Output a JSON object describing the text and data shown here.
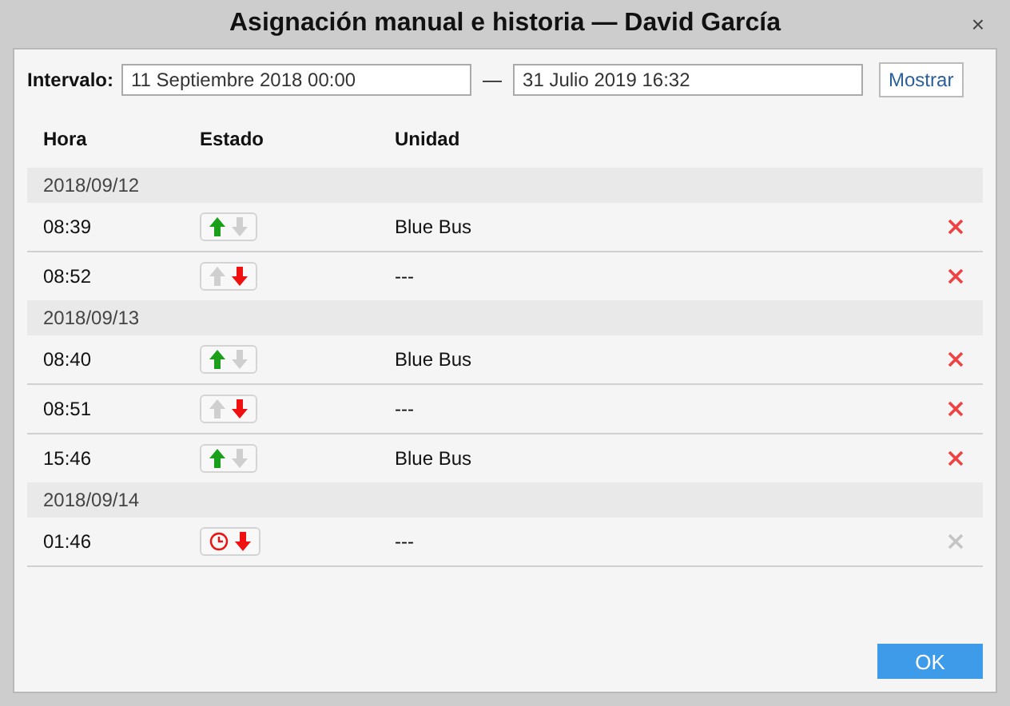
{
  "window": {
    "title": "Asignación manual e historia — David García",
    "close": "×"
  },
  "interval": {
    "label": "Intervalo:",
    "from": "11 Septiembre 2018 00:00",
    "separator": "—",
    "to": "31 Julio 2019 16:32",
    "button": "Mostrar"
  },
  "table": {
    "columns": [
      "Hora",
      "Estado",
      "Unidad"
    ],
    "groups": [
      {
        "date": "2018/09/12",
        "rows": [
          {
            "time": "08:39",
            "entered": true,
            "kind": "arrow",
            "unit": "Blue Bus",
            "delete_disabled": false
          },
          {
            "time": "08:52",
            "entered": false,
            "kind": "arrow",
            "unit": "---",
            "delete_disabled": false
          }
        ]
      },
      {
        "date": "2018/09/13",
        "rows": [
          {
            "time": "08:40",
            "entered": true,
            "kind": "arrow",
            "unit": "Blue Bus",
            "delete_disabled": false
          },
          {
            "time": "08:51",
            "entered": false,
            "kind": "arrow",
            "unit": "---",
            "delete_disabled": false
          },
          {
            "time": "15:46",
            "entered": true,
            "kind": "arrow",
            "unit": "Blue Bus",
            "delete_disabled": false
          }
        ]
      },
      {
        "date": "2018/09/14",
        "rows": [
          {
            "time": "01:46",
            "entered": false,
            "kind": "clock",
            "unit": "---",
            "delete_disabled": true
          }
        ]
      }
    ]
  },
  "buttons": [
    "OK"
  ]
}
